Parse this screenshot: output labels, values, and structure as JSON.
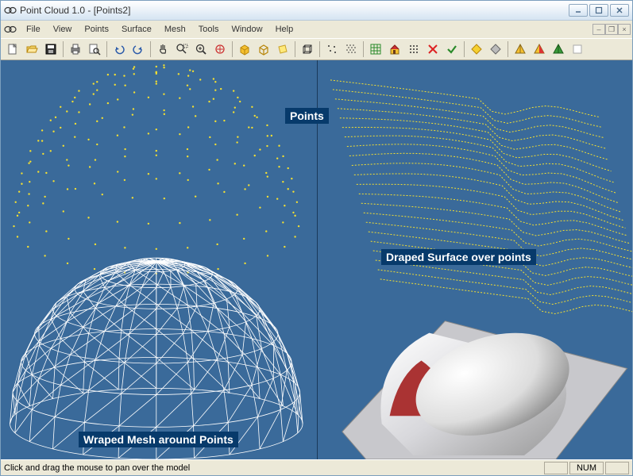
{
  "window": {
    "title": "Point Cloud 1.0 - [Points2]"
  },
  "menubar": {
    "items": [
      "File",
      "View",
      "Points",
      "Surface",
      "Mesh",
      "Tools",
      "Window",
      "Help"
    ]
  },
  "toolbar": {
    "groups": [
      [
        "new",
        "open",
        "save"
      ],
      [
        "print",
        "print-preview"
      ],
      [
        "undo",
        "redo"
      ],
      [
        "pan",
        "zoom-window",
        "zoom",
        "zoom-extents"
      ],
      [
        "box-yellow",
        "box-outline",
        "sheet"
      ],
      [
        "cube-wire"
      ],
      [
        "points-sparse",
        "points-dense"
      ],
      [
        "grid-green",
        "house",
        "grid-dots",
        "delete-red",
        "check-green"
      ],
      [
        "diamond-yellow",
        "diamond-gray"
      ],
      [
        "pyramid1",
        "pyramid2",
        "pyramid-green",
        "blank"
      ]
    ]
  },
  "viewport": {
    "labels": {
      "points": "Points",
      "draped": "Draped Surface over points",
      "wrapped": "Wraped Mesh around Points"
    }
  },
  "statusbar": {
    "text": "Click and drag the mouse to pan over the model",
    "num": "NUM"
  }
}
